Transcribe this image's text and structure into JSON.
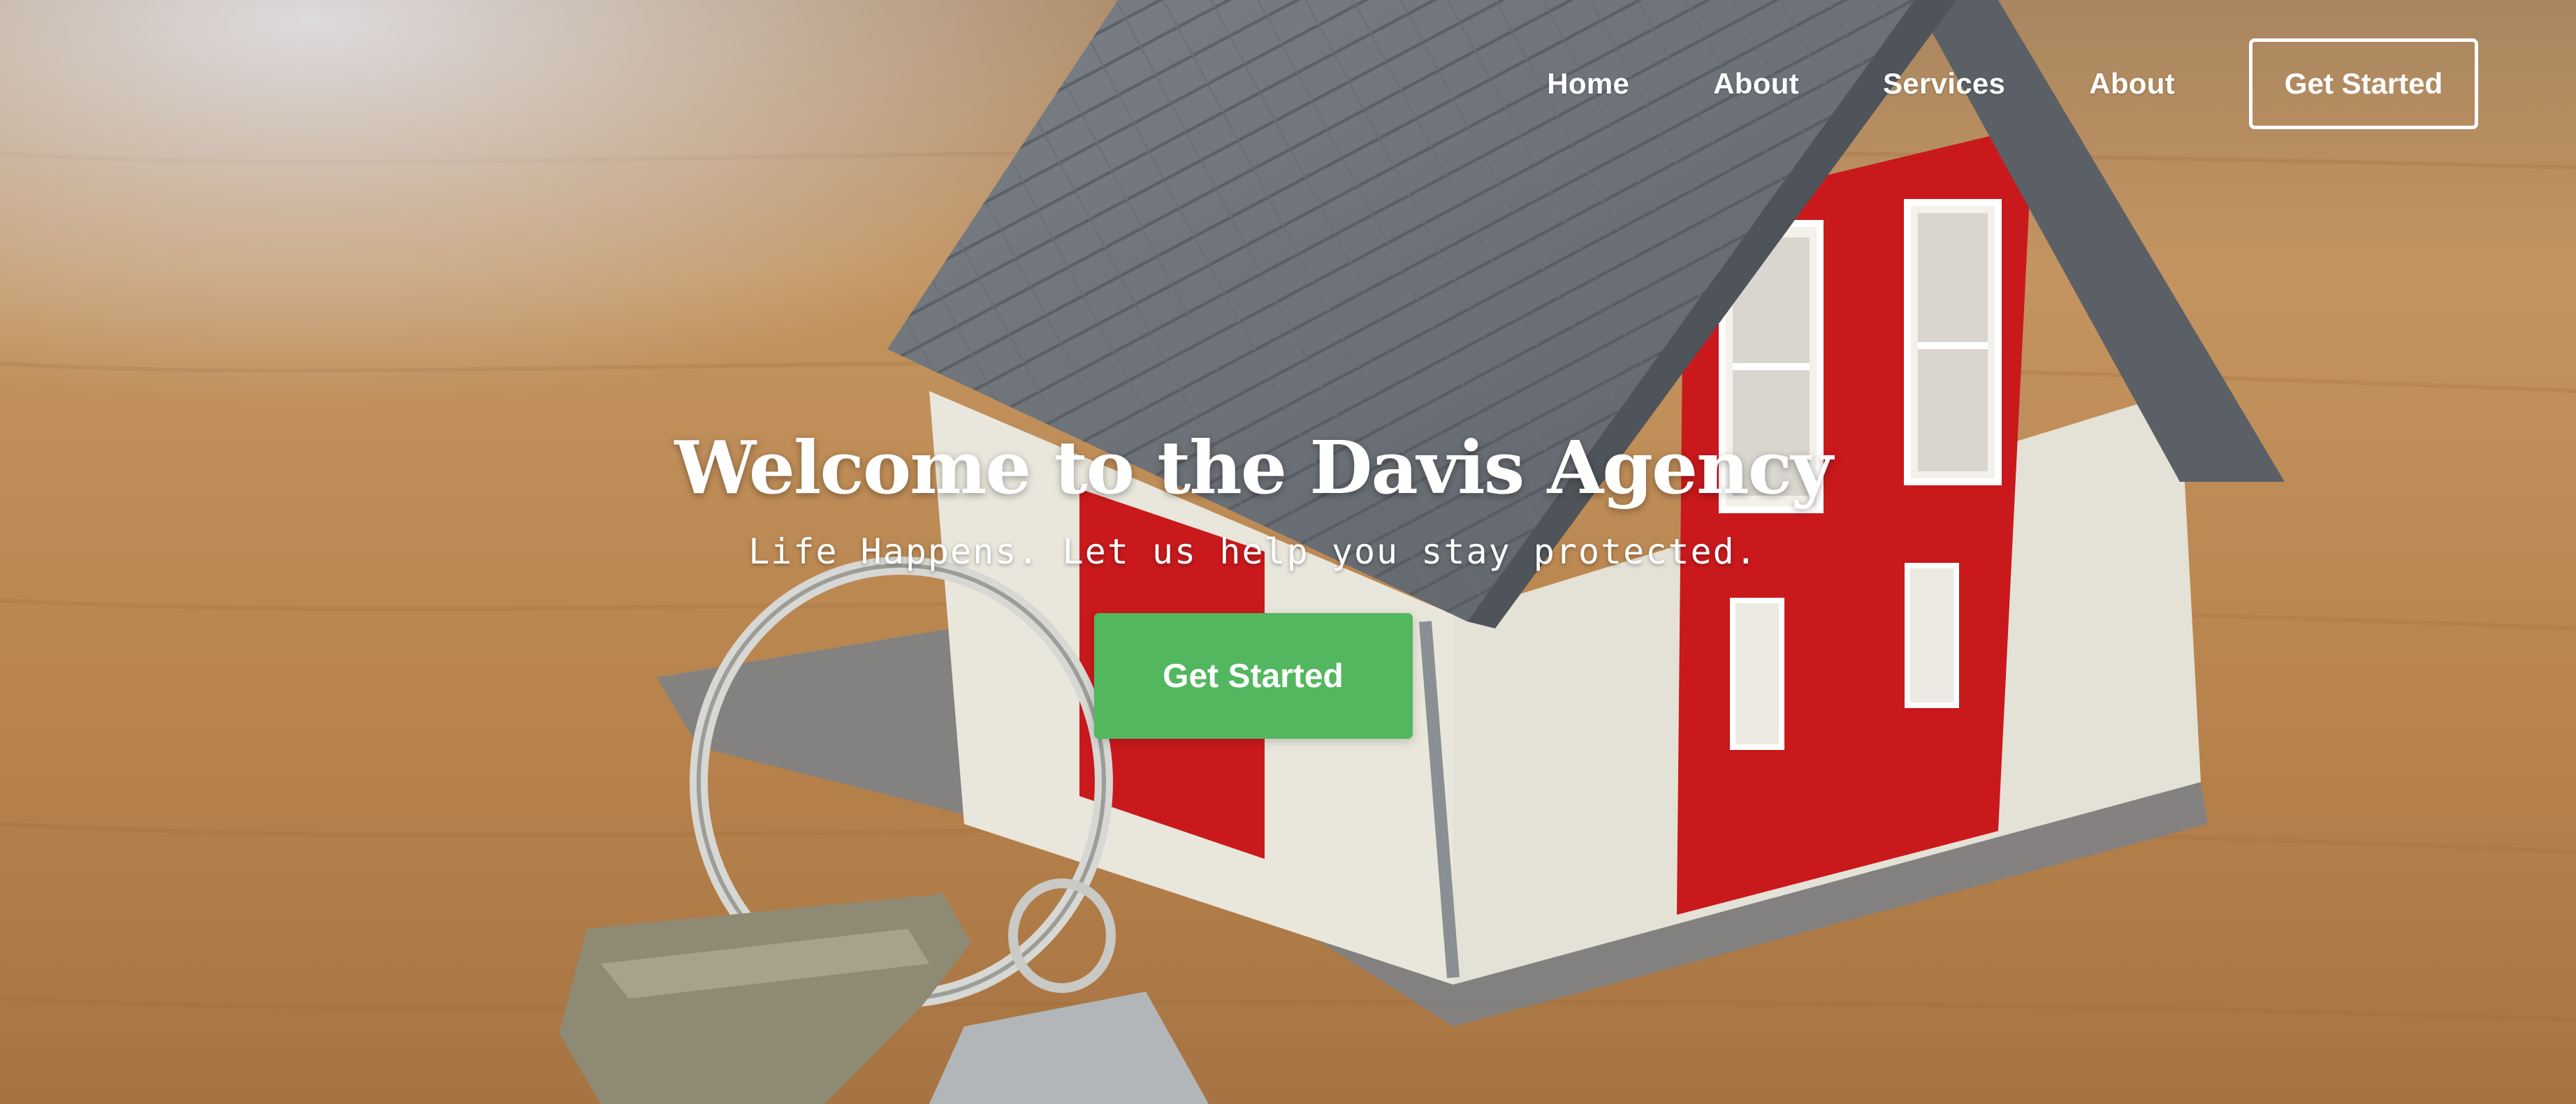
{
  "nav": {
    "items": [
      {
        "label": "Home"
      },
      {
        "label": "About"
      },
      {
        "label": "Services"
      },
      {
        "label": "About"
      }
    ],
    "cta_label": "Get Started"
  },
  "hero": {
    "title": "Welcome to the Davis Agency",
    "subtitle": "Life Happens. Let us help you stay protected.",
    "cta_label": "Get Started"
  },
  "colors": {
    "cta_green": "#53b75f",
    "nav_text": "#ffffff",
    "wood_background": "#b98a52",
    "house_roof": "#6f757b",
    "house_red": "#c9191c"
  }
}
